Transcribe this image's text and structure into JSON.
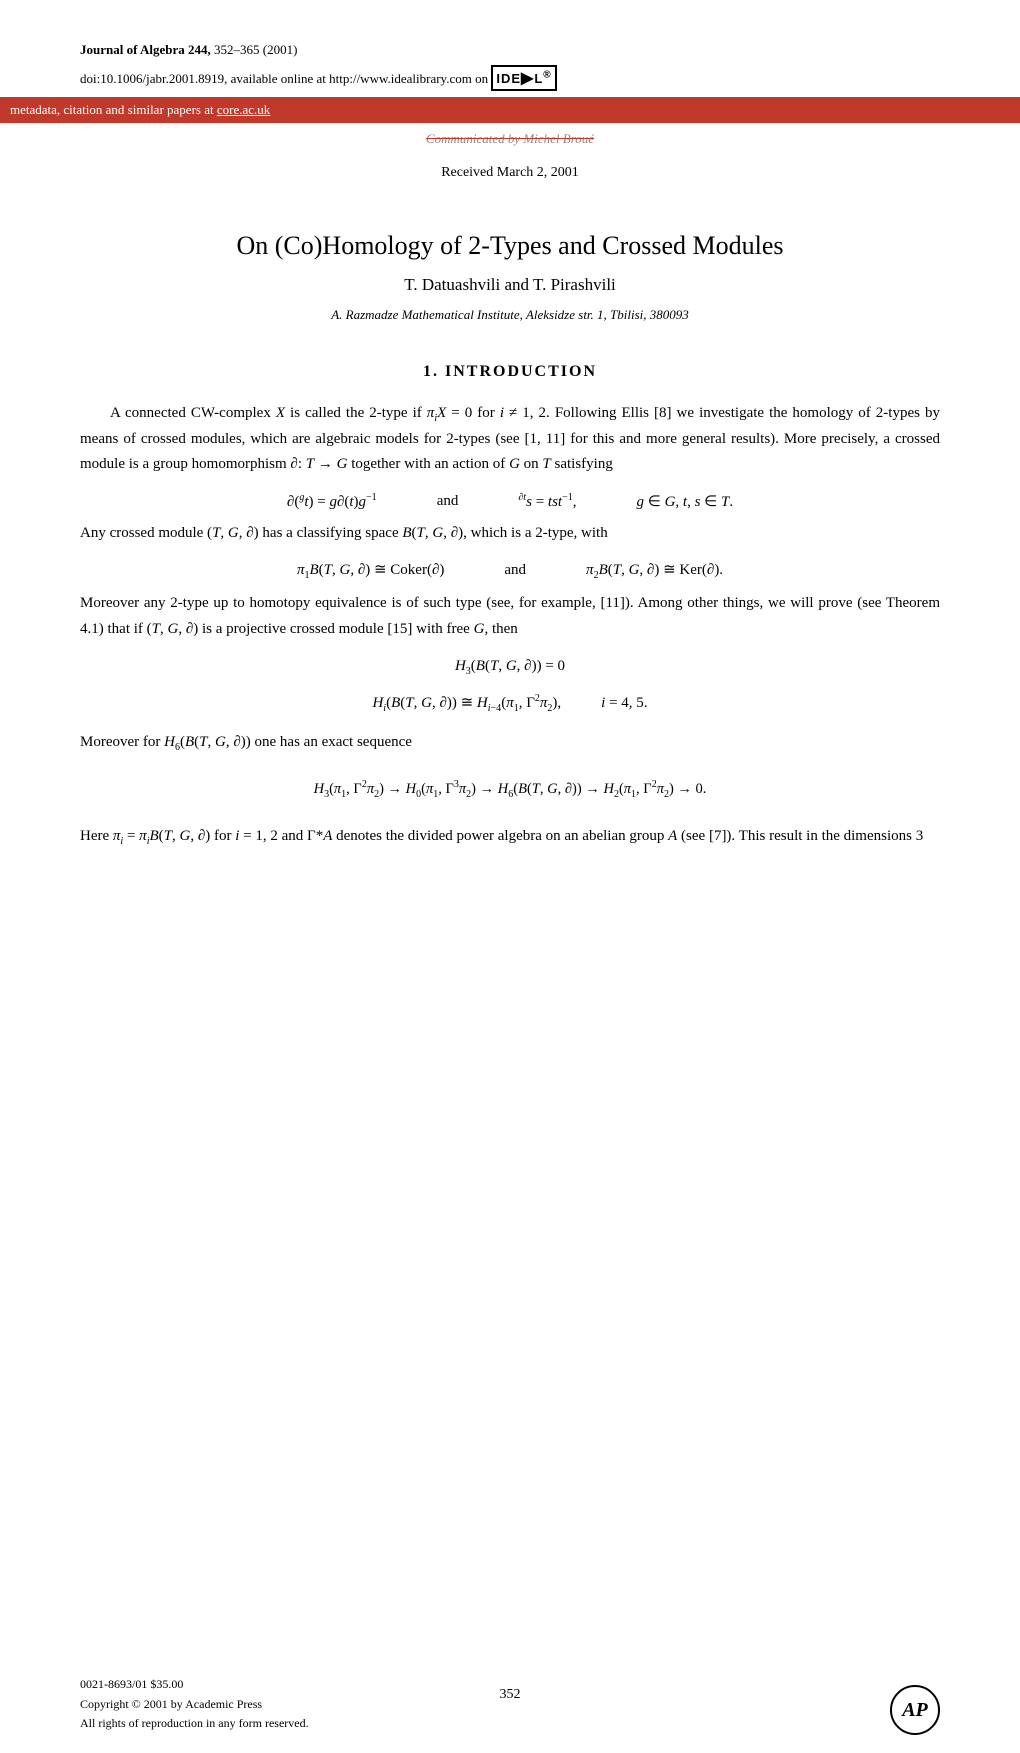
{
  "header": {
    "journal": "Journal of Algebra",
    "volume": "244,",
    "pages": "352–365 (2001)",
    "doi": "doi:10.1006/jabr.2001.8919, available online at http://www.idealibrary.com on",
    "logo_text": "IDEA L",
    "logo_sup": "®"
  },
  "banner": {
    "text": "metadata, citation and similar papers at",
    "link_text": "core.ac.uk",
    "link_href": "https://core.ac.uk"
  },
  "communicated": {
    "text": "Communicated by Michel Broué"
  },
  "received": {
    "text": "Received March 2, 2001"
  },
  "title": {
    "main": "On (Co)Homology of 2-Types and Crossed Modules",
    "authors": "T. Datuashvili and T. Pirashvili",
    "affiliation": "A. Razmadze Mathematical Institute, Aleksidze str. 1, Tbilisi, 380093"
  },
  "section1": {
    "heading": "1.  INTRODUCTION",
    "paragraph1": "A connected CW-complex X is called the 2-type if π",
    "paragraph1b": "X = 0 for i ≠ 1, 2. Following Ellis [8] we investigate the homology of 2-types by means of crossed modules, which are algebraic models for 2-types (see [1, 11] for this and more general results). More precisely, a crossed module is a group homomorphism ∂: T → G together with an action of G on T satisfying",
    "formula1_left": "∂(ᵍt) = g∂(t)g⁻¹",
    "formula1_and": "and",
    "formula1_right": "∂ᵗs = tst⁻¹,",
    "formula1_condition": "g ∈ G, t, s ∈ T.",
    "paragraph2": "Any crossed module (T, G, ∂) has a classifying space B(T, G, ∂), which is a 2-type, with",
    "formula2_left": "π₁B(T, G, ∂) ≅ Coker(∂)",
    "formula2_and": "and",
    "formula2_right": "π₂B(T, G, ∂) ≅ Ker(∂).",
    "paragraph3": "Moreover any 2-type up to homotopy equivalence is of such type (see, for example, [11]). Among other things, we will prove (see Theorem 4.1) that if (T, G, ∂) is a projective crossed module [15] with free G, then",
    "formula3a": "H₃(B(T, G, ∂)) = 0",
    "formula3b": "Hᵢ(B(T, G, ∂)) ≅ Hᵢ₋₄(π₁, Γ²π₂),",
    "formula3b_right": "i = 4, 5.",
    "paragraph4": "Moreover for H₆(B(T, G, ∂)) one has an exact sequence",
    "long_seq": "H₃(π₁, Γ²π₂) → H₀(π₁, Γ³π₂) → H₆(B(T, G, ∂)) → H₂(π₁, Γ²π₂) → 0.",
    "paragraph5": "Here πᵢ = πᵢB(T, G, ∂) for i = 1, 2 and Γ*A denotes the divided power algebra on an abelian group A (see [7]). This result in the dimensions 3"
  },
  "footer": {
    "page_number": "352",
    "copyright_line1": "0021-8693/01 $35.00",
    "copyright_line2": "Copyright © 2001 by Academic Press",
    "copyright_line3": "All rights of reproduction in any form reserved.",
    "ap_logo": "AP"
  }
}
